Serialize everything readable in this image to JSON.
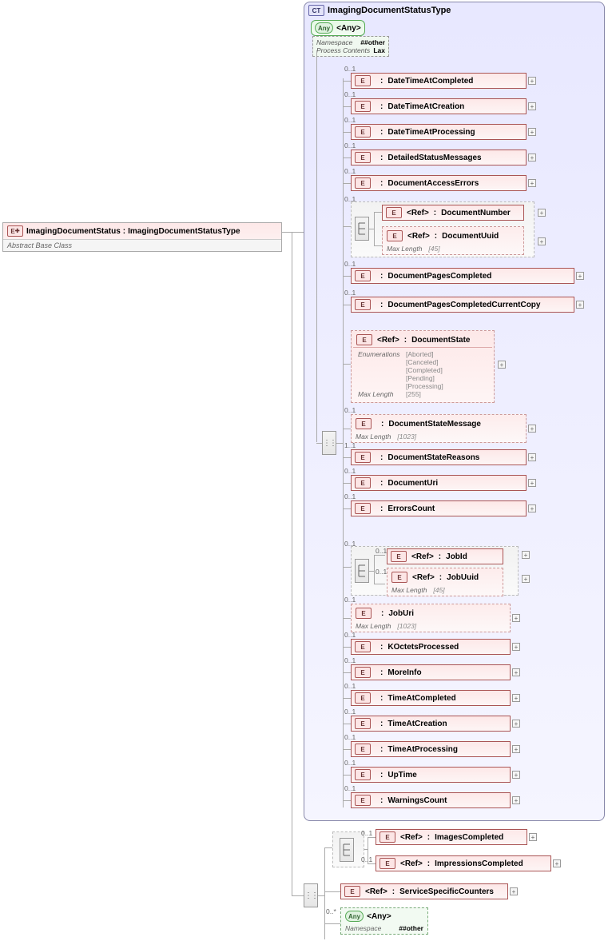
{
  "root": {
    "badge": "E",
    "name": "ImagingDocumentStatus",
    "type": "ImagingDocumentStatusType",
    "note": "Abstract Base Class"
  },
  "ct": {
    "badge": "CT",
    "name": "ImagingDocumentStatusType"
  },
  "any": {
    "badge": "Any",
    "label": "<Any>",
    "namespace_k": "Namespace",
    "namespace_v": "##other",
    "process_k": "Process Contents",
    "process_v": "Lax"
  },
  "refs": {
    "ref_label": "<Ref>",
    "e_badge": "E",
    "items": [
      {
        "occ": "0..1",
        "name": "DateTimeAtCompleted"
      },
      {
        "occ": "0..1",
        "name": "DateTimeAtCreation"
      },
      {
        "occ": "0..1",
        "name": "DateTimeAtProcessing"
      },
      {
        "occ": "0..1",
        "name": "DetailedStatusMessages"
      },
      {
        "occ": "0..1",
        "name": "DocumentAccessErrors"
      }
    ],
    "choice1": {
      "occ": "0..1",
      "items": [
        {
          "name": "DocumentNumber",
          "occ": ""
        },
        {
          "name": "DocumentUuid",
          "occ": "",
          "meta_k": "Max Length",
          "meta_v": "[45]"
        }
      ]
    },
    "items2": [
      {
        "occ": "0..1",
        "name": "DocumentPagesCompleted"
      },
      {
        "occ": "0..1",
        "name": "DocumentPagesCompletedCurrentCopy"
      }
    ],
    "docstate": {
      "name": "DocumentState",
      "enum_k": "Enumerations",
      "enums": [
        "[Aborted]",
        "[Canceled]",
        "[Completed]",
        "[Pending]",
        "[Processing]"
      ],
      "ml_k": "Max Length",
      "ml_v": "[255]"
    },
    "items3": [
      {
        "occ": "0..1",
        "name": "DocumentStateMessage",
        "meta_k": "Max Length",
        "meta_v": "[1023]"
      },
      {
        "occ": "1..1",
        "name": "DocumentStateReasons"
      },
      {
        "occ": "0..1",
        "name": "DocumentUri"
      },
      {
        "occ": "0..1",
        "name": "ErrorsCount"
      }
    ],
    "choice2": {
      "occ": "0..1",
      "items": [
        {
          "occ": "0..1",
          "name": "JobId"
        },
        {
          "occ": "0..1",
          "name": "JobUuid",
          "meta_k": "Max Length",
          "meta_v": "[45]"
        }
      ]
    },
    "items4": [
      {
        "occ": "0..1",
        "name": "JobUri",
        "meta_k": "Max Length",
        "meta_v": "[1023]"
      },
      {
        "occ": "0..1",
        "name": "KOctetsProcessed"
      },
      {
        "occ": "0..1",
        "name": "MoreInfo"
      },
      {
        "occ": "0..1",
        "name": "TimeAtCompleted"
      },
      {
        "occ": "0..1",
        "name": "TimeAtCreation"
      },
      {
        "occ": "0..1",
        "name": "TimeAtProcessing"
      },
      {
        "occ": "0..1",
        "name": "UpTime"
      },
      {
        "occ": "0..1",
        "name": "WarningsCount"
      }
    ]
  },
  "lower": {
    "choice": {
      "items": [
        {
          "occ": "0..1",
          "name": "ImagesCompleted"
        },
        {
          "occ": "0..1",
          "name": "ImpressionsCompleted"
        }
      ]
    },
    "ssc": {
      "name": "ServiceSpecificCounters"
    },
    "any": {
      "occ": "0..*",
      "badge": "Any",
      "label": "<Any>",
      "ns_k": "Namespace",
      "ns_v": "##other"
    }
  }
}
